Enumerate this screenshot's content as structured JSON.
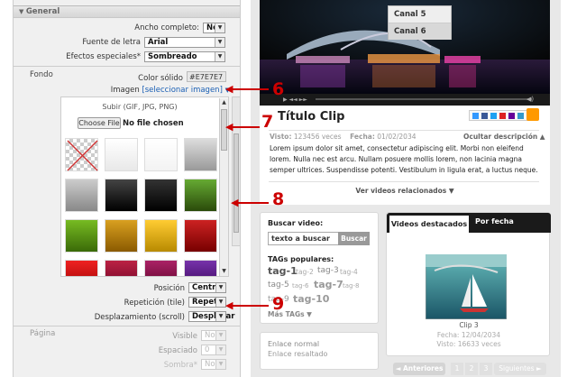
{
  "general": {
    "header": "General",
    "ancho_label": "Ancho completo:",
    "ancho_value": "No",
    "fuente_label": "Fuente de letra",
    "fuente_value": "Arial",
    "efectos_label": "Efectos especiales*",
    "efectos_value": "Sombreado"
  },
  "fondo": {
    "label": "Fondo",
    "color_label": "Color sólido",
    "color_value": "#E7E7E7",
    "imagen_label": "Imagen",
    "imagen_link": "[seleccionar imagen",
    "imagen_close": "]",
    "subir_label": "Subir (GIF, JPG, PNG)",
    "choose_file": "Choose File",
    "no_file": "No file chosen",
    "posicion_label": "Posición",
    "posicion_value": "Centro",
    "repeticion_label": "Repetición (tile)",
    "repeticion_value": "Repetir",
    "desplazamiento_label": "Desplazamiento (scroll)",
    "desplazamiento_value": "Desplazar"
  },
  "pagina": {
    "label": "Página",
    "visible_label": "Visible",
    "visible_value": "No",
    "espaciado_label": "Espaciado",
    "espaciado_value": "0",
    "sombra_label": "Sombra*",
    "sombra_value": "No"
  },
  "swatches": [
    "transparent",
    "#f2f2f2",
    "#ffffff",
    "#bdbdbd",
    "#a8a8a8",
    "#202020",
    "#111111",
    "#3f7d14",
    "#4f8a10",
    "#b8860b",
    "#d4a017",
    "#a01818",
    "#c81e1e",
    "#8a1a4a",
    "#7a1a6a",
    "#5a1a7a"
  ],
  "callouts": [
    "6",
    "7",
    "8",
    "9"
  ],
  "video": {
    "channels": [
      "Canal 5",
      "Canal 6"
    ],
    "title": "Título Clip",
    "visto_label": "Visto:",
    "visto_value": "123456 veces",
    "fecha_label": "Fecha:",
    "fecha_value": "01/02/2034",
    "ocultar": "Ocultar descripción ▲",
    "description": "Lorem ipsum dolor sit amet, consectetur adipiscing elit. Morbi non eleifend lorem. Nulla nec est arcu. Nullam posuere mollis lorem, non lacinia magna semper ultrices. Suspendisse potenti. Vestibulum in ligula erat, a luctus neque.",
    "related": "Ver videos relacionados ▼"
  },
  "search": {
    "title": "Buscar video:",
    "input_value": "texto a buscar",
    "button": "Buscar",
    "tags_title": "TAGs populares:",
    "tags": [
      {
        "t": "tag-1",
        "s": "big"
      },
      {
        "t": "tag-2",
        "s": "small"
      },
      {
        "t": "tag-3",
        "s": "mid"
      },
      {
        "t": "tag-4",
        "s": "small"
      },
      {
        "t": "tag-5",
        "s": "mid"
      },
      {
        "t": "tag-6",
        "s": "small"
      },
      {
        "t": "tag-7",
        "s": "big"
      },
      {
        "t": "tag-8",
        "s": "small"
      },
      {
        "t": "tag-9",
        "s": "mid"
      },
      {
        "t": "tag-10",
        "s": "big"
      }
    ],
    "more": "Más TAGs ▼"
  },
  "links": {
    "normal": "Enlace normal",
    "resaltado": "Enlace resaltado"
  },
  "featured": {
    "tab_active": "Videos destacados",
    "tab_other": "Por fecha",
    "clip_title": "Clip 3",
    "clip_fecha": "Fecha: 12/04/2034",
    "clip_visto": "Visto: 16633 veces"
  },
  "pager": {
    "prev": "◄ Anteriores",
    "pages": [
      "1",
      "2",
      "3"
    ],
    "next": "Siguientes ►"
  }
}
